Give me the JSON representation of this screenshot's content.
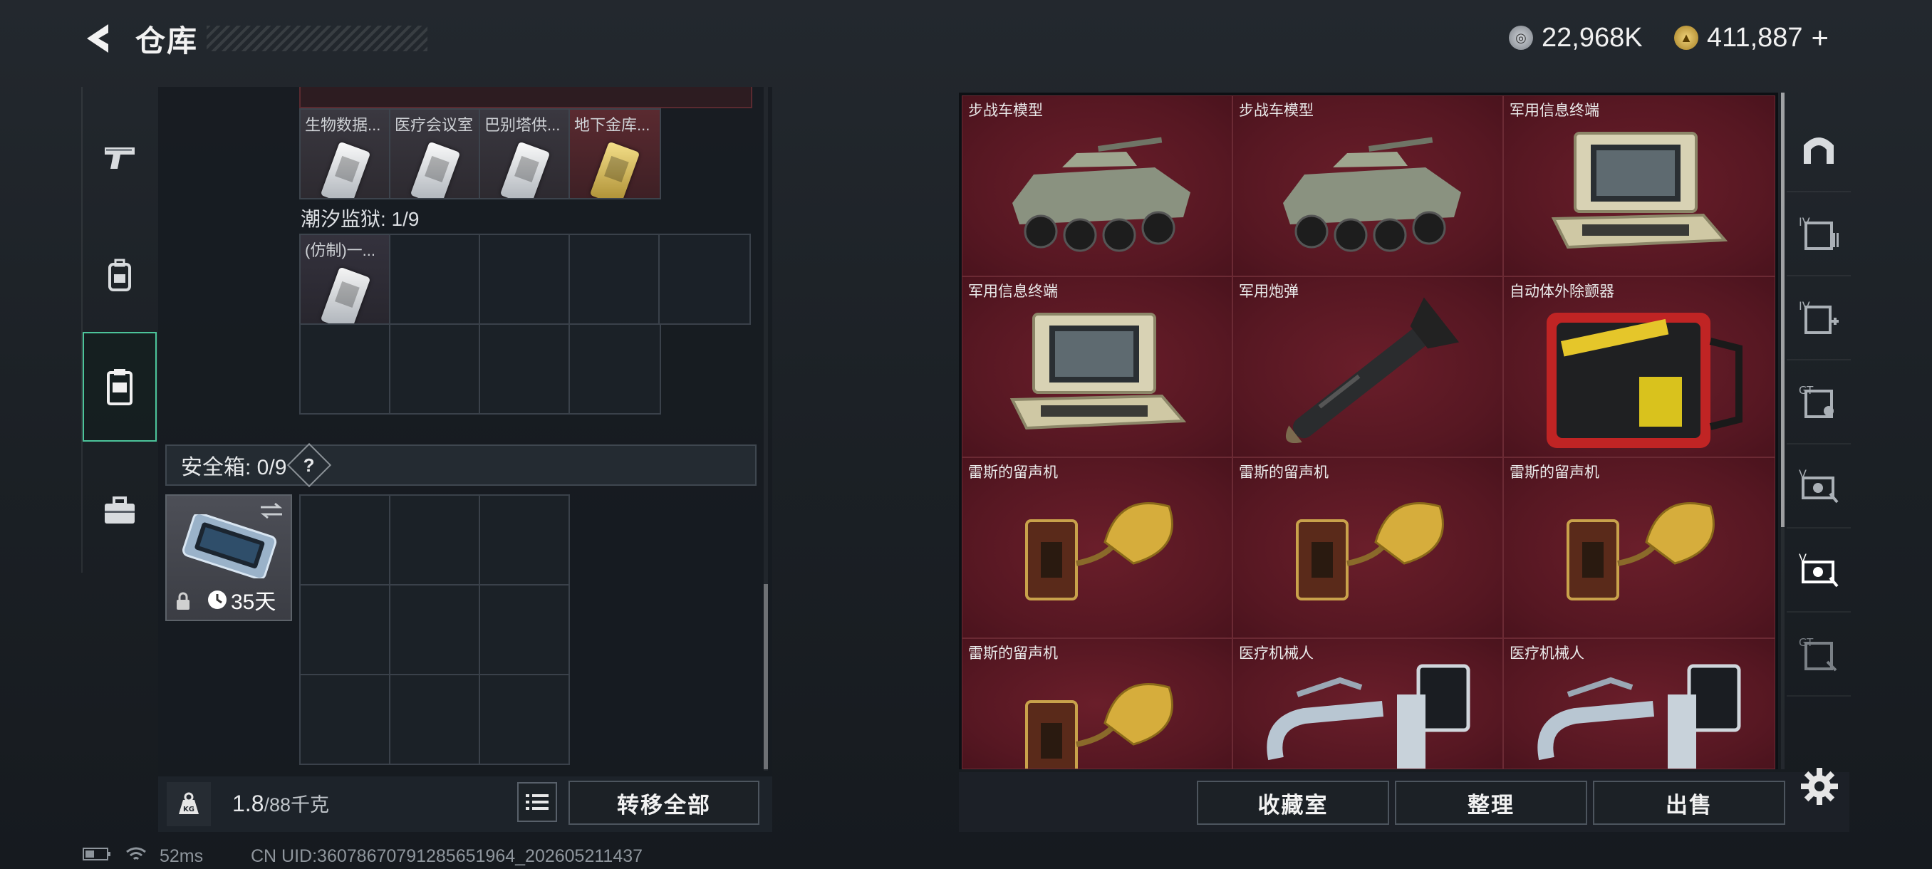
{
  "header": {
    "title": "仓库",
    "currency1": {
      "icon": "silver-coin-icon",
      "value": "22,968K"
    },
    "currency2": {
      "icon": "gold-coin-icon",
      "value": "411,887",
      "add_symbol": "+"
    }
  },
  "left_nav": [
    {
      "name": "weapons-tab",
      "icon": "pistol-icon",
      "active": false
    },
    {
      "name": "gear-tab",
      "icon": "backpack-icon",
      "active": false
    },
    {
      "name": "containers-tab",
      "icon": "clipboard-icon",
      "active": true
    },
    {
      "name": "case-tab",
      "icon": "briefcase-icon",
      "active": false
    }
  ],
  "inventory": {
    "top_items": [
      {
        "label": "生物数据...",
        "style": "white"
      },
      {
        "label": "医疗会议室",
        "style": "white"
      },
      {
        "label": "巴别塔供...",
        "style": "white"
      },
      {
        "label": "地下金库...",
        "style": "gold"
      }
    ],
    "prison_section": {
      "label": "潮汐监狱: 1/9",
      "item_label": "(仿制)一..."
    },
    "safe_box": {
      "label": "安全箱: 0/9",
      "help": "?",
      "days": "35天"
    },
    "weight": {
      "current": "1.8",
      "max": "/88千克"
    },
    "transfer_all": "转移全部"
  },
  "stash": {
    "items": [
      {
        "label": "步战车模型",
        "art": "ifv"
      },
      {
        "label": "步战车模型",
        "art": "ifv"
      },
      {
        "label": "军用信息终端",
        "art": "terminal"
      },
      {
        "label": "军用信息终端",
        "art": "terminal"
      },
      {
        "label": "军用炮弹",
        "art": "shell"
      },
      {
        "label": "自动体外除颤器",
        "art": "aed"
      },
      {
        "label": "雷斯的留声机",
        "art": "gramophone"
      },
      {
        "label": "雷斯的留声机",
        "art": "gramophone"
      },
      {
        "label": "雷斯的留声机",
        "art": "gramophone"
      },
      {
        "label": "雷斯的留声机",
        "art": "gramophone"
      },
      {
        "label": "医疗机械人",
        "art": "robot"
      },
      {
        "label": "医疗机械人",
        "art": "robot"
      }
    ],
    "buttons": {
      "collection": "收藏室",
      "organize": "整理",
      "sell": "出售"
    }
  },
  "right_nav": [
    {
      "name": "right-tab-home",
      "icon": "arch-icon",
      "tag": ""
    },
    {
      "name": "right-tab-iv-1",
      "icon": "page-list-icon",
      "tag": "IV"
    },
    {
      "name": "right-tab-iv-2",
      "icon": "page-add-icon",
      "tag": "IV"
    },
    {
      "name": "right-tab-gt-1",
      "icon": "page-gt-icon",
      "tag": "GT"
    },
    {
      "name": "right-tab-v-1",
      "icon": "page-v-icon",
      "tag": "V"
    },
    {
      "name": "right-tab-v-2",
      "icon": "page-v-icon",
      "tag": "V",
      "active": true
    },
    {
      "name": "right-tab-gt-2",
      "icon": "page-gt-icon",
      "tag": "GT"
    }
  ],
  "status_bar": {
    "ping": "52ms",
    "uid": "CN UID:36078670791285651964_202605211437"
  },
  "colors": {
    "accent": "#4cc49a",
    "item_red": "#5a1a25",
    "gold_item": "#b39a3c"
  }
}
